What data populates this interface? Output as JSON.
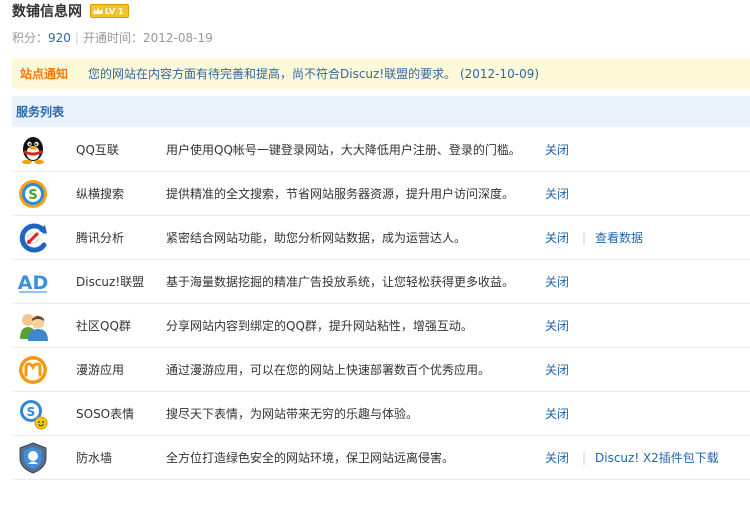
{
  "header": {
    "site_name": "数铺信息网",
    "level_badge": "LV 1",
    "points_label": "积分：",
    "points_value": "920",
    "separator": "|",
    "open_date_label": "开通时间：",
    "open_date_value": "2012-08-19"
  },
  "notice": {
    "label": "站点通知",
    "text": "您的网站在内容方面有待完善和提高，尚不符合Discuz!联盟的要求。 (2012-10-09)"
  },
  "services_title": "服务列表",
  "services": [
    {
      "icon": "qq-penguin-icon",
      "name": "QQ互联",
      "desc": "用户使用QQ帐号一键登录网站，大大降低用户注册、登录的门槛。",
      "action": "关闭",
      "extra": ""
    },
    {
      "icon": "soso-search-icon",
      "name": "纵横搜索",
      "desc": "提供精准的全文搜索，节省网站服务器资源，提升用户访问深度。",
      "action": "关闭",
      "extra": ""
    },
    {
      "icon": "analytics-icon",
      "name": "腾讯分析",
      "desc": "紧密结合网站功能，助您分析网站数据，成为运营达人。",
      "action": "关闭",
      "extra": "查看数据"
    },
    {
      "icon": "ad-icon",
      "name": "Discuz!联盟",
      "desc": "基于海量数据挖掘的精准广告投放系统，让您轻松获得更多收益。",
      "action": "关闭",
      "extra": ""
    },
    {
      "icon": "group-users-icon",
      "name": "社区QQ群",
      "desc": "分享网站内容到绑定的QQ群，提升网站粘性，增强互动。",
      "action": "关闭",
      "extra": ""
    },
    {
      "icon": "manyou-icon",
      "name": "漫游应用",
      "desc": "通过漫游应用，可以在您的网站上快速部署数百个优秀应用。",
      "action": "关闭",
      "extra": ""
    },
    {
      "icon": "soso-emoticon-icon",
      "name": "SOSO表情",
      "desc": "搜尽天下表情，为网站带来无穷的乐趣与体验。",
      "action": "关闭",
      "extra": ""
    },
    {
      "icon": "firewall-shield-icon",
      "name": "防水墙",
      "desc": "全方位打造绿色安全的网站环境，保卫网站远离侵害。",
      "action": "关闭",
      "extra": "Discuz! X2插件包下载"
    }
  ]
}
